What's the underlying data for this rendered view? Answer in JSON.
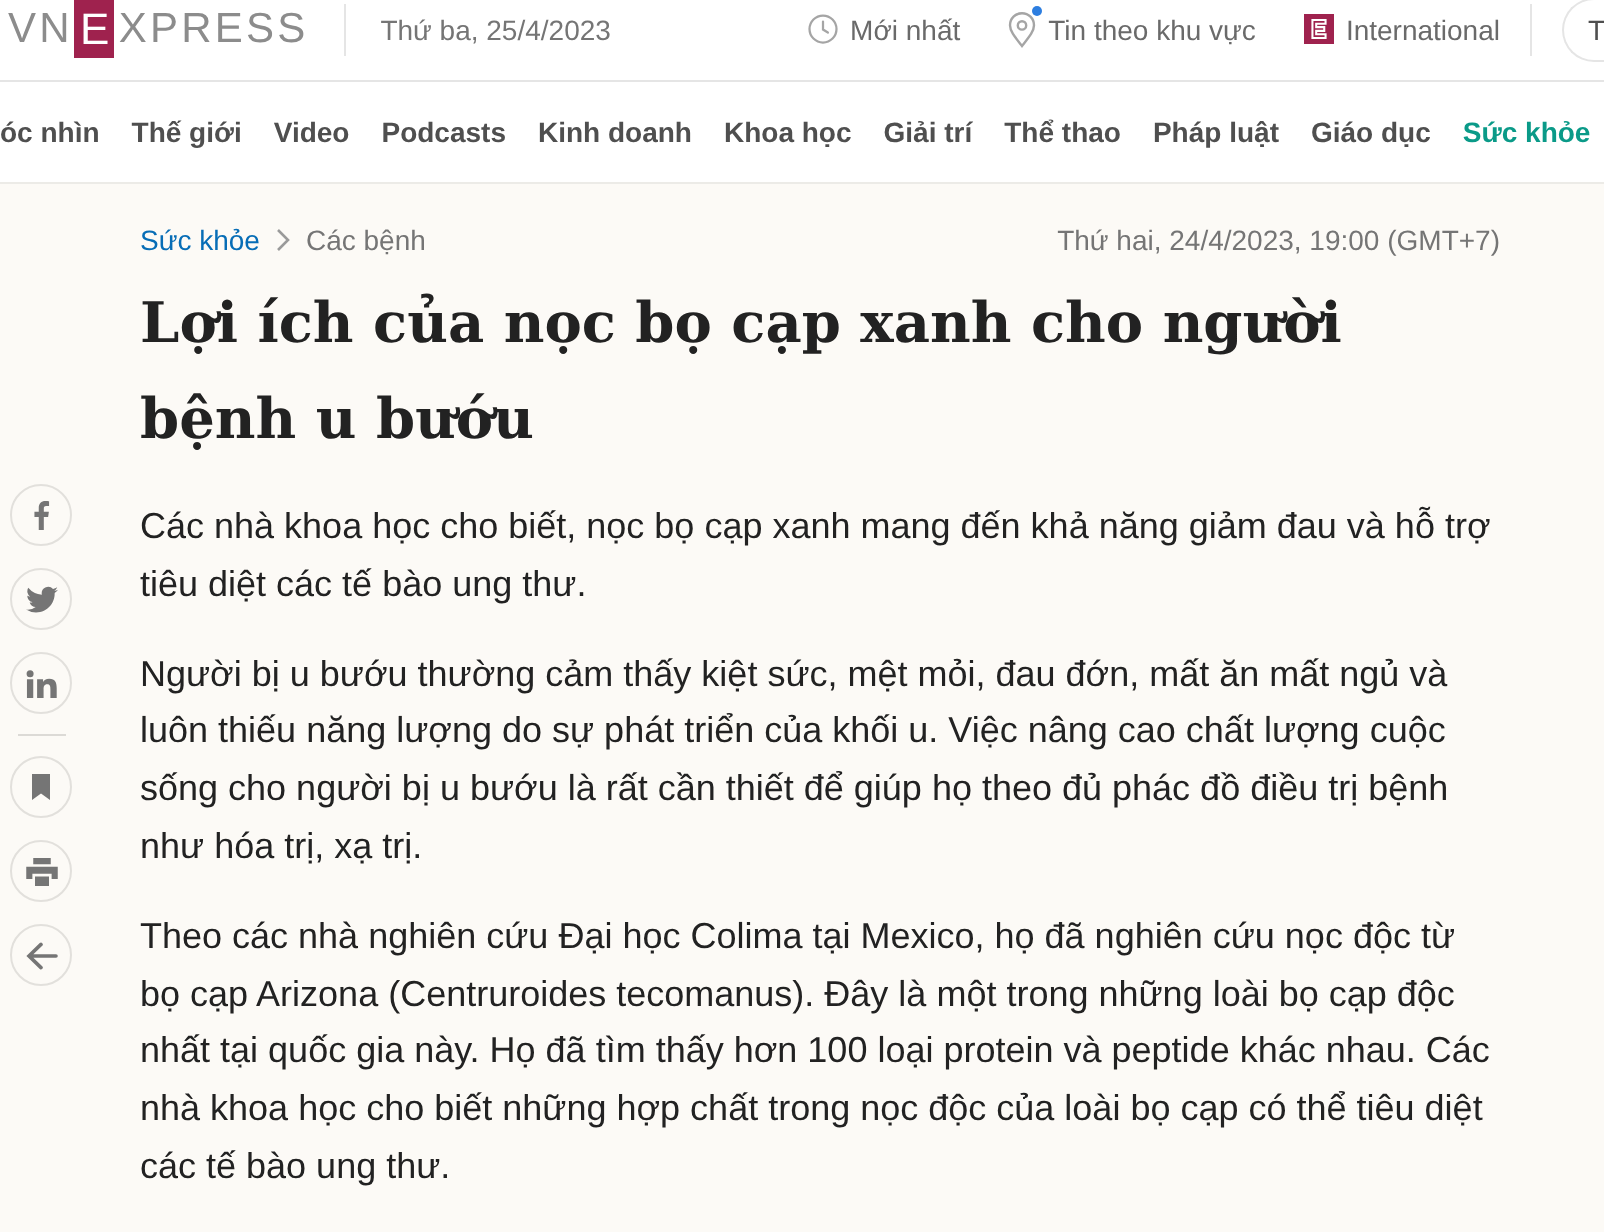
{
  "header": {
    "logo": {
      "left": "VN",
      "boxed": "E",
      "right": "XPRESS"
    },
    "date": "Thứ ba, 25/4/2023",
    "links": [
      {
        "kind": "latest",
        "label": "Mới nhất"
      },
      {
        "kind": "local",
        "label": "Tin theo khu vực"
      },
      {
        "kind": "international",
        "label": "International"
      }
    ],
    "cut_button": "T"
  },
  "nav": [
    {
      "label": "óc nhìn",
      "selected": false
    },
    {
      "label": "Thế giới",
      "selected": false
    },
    {
      "label": "Video",
      "selected": false
    },
    {
      "label": "Podcasts",
      "selected": false
    },
    {
      "label": "Kinh doanh",
      "selected": false
    },
    {
      "label": "Khoa học",
      "selected": false
    },
    {
      "label": "Giải trí",
      "selected": false
    },
    {
      "label": "Thể thao",
      "selected": false
    },
    {
      "label": "Pháp luật",
      "selected": false
    },
    {
      "label": "Giáo dục",
      "selected": false
    },
    {
      "label": "Sức khỏe",
      "selected": true
    }
  ],
  "article": {
    "breadcrumb": [
      "Sức khỏe",
      "Các bệnh"
    ],
    "date": "Thứ hai, 24/4/2023, 19:00 (GMT+7)",
    "title": "Lợi ích của nọc bọ cạp xanh cho người bệnh u bướu",
    "lead": "Các nhà khoa học cho biết, nọc bọ cạp xanh mang đến khả năng giảm đau và hỗ trợ tiêu diệt các tế bào ung thư.",
    "paragraphs": [
      "Người bị u bướu thường cảm thấy kiệt sức, mệt mỏi, đau đớn, mất ăn mất ngủ và luôn thiếu năng lượng do sự phát triển của khối u. Việc nâng cao chất lượng cuộc sống cho người bị u bướu là rất cần thiết để giúp họ theo đủ phác đồ điều trị bệnh như hóa trị, xạ trị.",
      "Theo các nhà nghiên cứu Đại học Colima tại Mexico, họ đã nghiên cứu nọc độc từ bọ cạp Arizona (Centruroides tecomanus). Đây là một trong những loài bọ cạp độc nhất tại quốc gia này. Họ đã tìm thấy hơn 100 loại protein và peptide khác nhau. Các nhà khoa học cho biết những hợp chất trong nọc độc của loài bọ cạp có thể tiêu diệt các tế bào ung thư."
    ]
  }
}
